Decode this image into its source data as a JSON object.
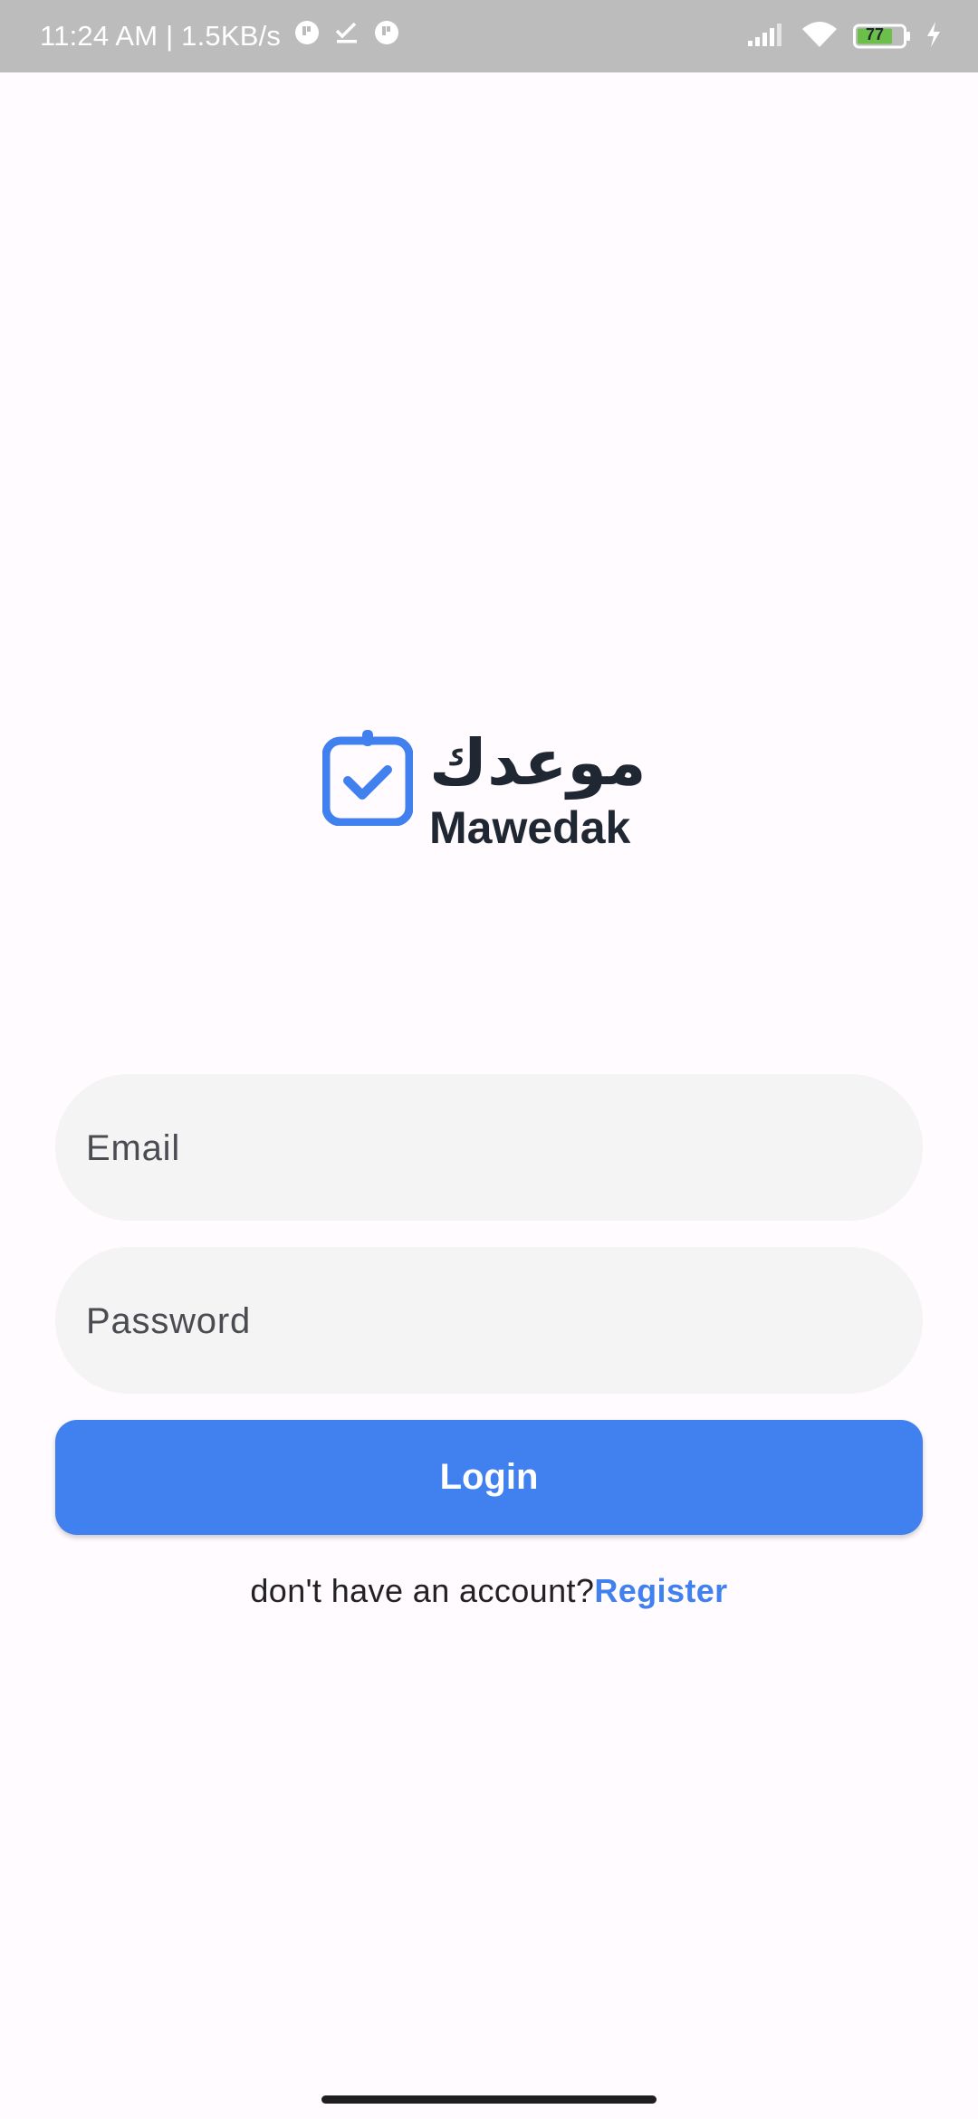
{
  "status_bar": {
    "time_speed": "11:24 AM | 1.5KB/s",
    "battery": "77"
  },
  "logo": {
    "arabic_text": "موعدك",
    "latin_text": "Mawedak"
  },
  "form": {
    "email_placeholder": "Email",
    "password_placeholder": "Password",
    "login_label": "Login"
  },
  "footer": {
    "prompt": "don't have an account?",
    "register_label": "Register"
  },
  "colors": {
    "accent": "#4081ef",
    "field_bg": "#f3f4f3",
    "background": "#fffbfe",
    "text_dark": "#1f2733"
  },
  "icons": [
    "calendar-check-icon",
    "signal-icon",
    "wifi-icon",
    "battery-icon",
    "charging-icon"
  ]
}
